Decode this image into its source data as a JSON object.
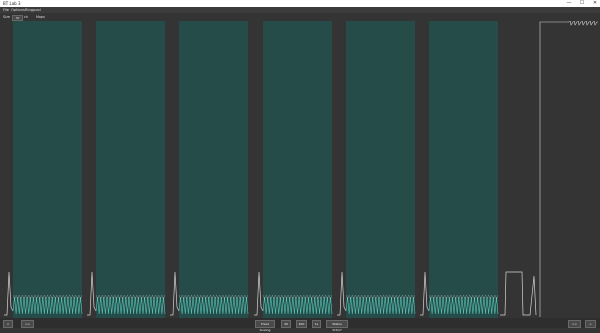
{
  "window": {
    "title": "BT Lab 3",
    "min": "—",
    "max": "☐",
    "close": "✕"
  },
  "menu": [
    "File",
    "Options",
    "Ringpool"
  ],
  "toolbar": {
    "size_label": "Size",
    "size_value": "30",
    "size_unit": "ch",
    "maps_label": "Maps"
  },
  "bottombar": {
    "prev_label": "<",
    "prev_all_label": "<<",
    "fixed_scaling_label": "Fixed Scaling",
    "scale_a": "30",
    "scale_b": "400",
    "scale_c": "1s",
    "coords_label": "Status 3/3/17",
    "next_all_label": ">>",
    "next_label": ">"
  },
  "colors": {
    "background": "#343434",
    "panel": "#264c49",
    "trace": "#d4d4d4",
    "cyan_trace": "#58c5b7"
  },
  "icons": {
    "minimize": "minimize-icon",
    "maximize": "maximize-icon",
    "close": "close-icon"
  }
}
